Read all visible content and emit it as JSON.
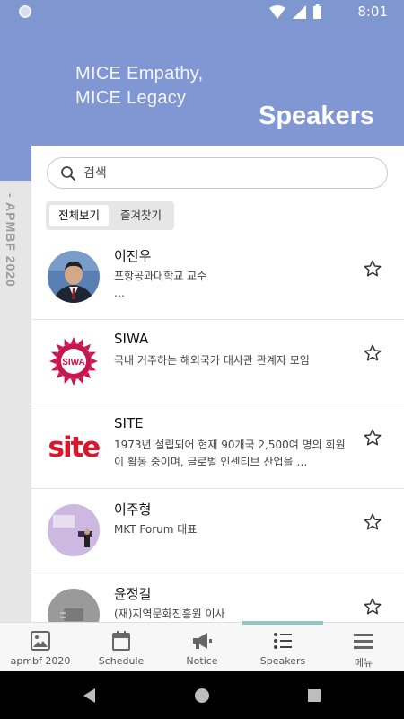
{
  "status_bar": {
    "time": "8:01"
  },
  "header": {
    "tagline_line1": "MICE Empathy,",
    "tagline_line2": "MICE Legacy",
    "title": "Speakers"
  },
  "side_label": "- APMBF 2020",
  "search": {
    "placeholder": "검색"
  },
  "filter_tabs": [
    {
      "label": "전체보기",
      "active": true
    },
    {
      "label": "즐겨찾기",
      "active": false
    }
  ],
  "speakers": [
    {
      "name": "이진우",
      "desc": "포항공과대학교 교수\n…",
      "favorited": false
    },
    {
      "name": "SIWA",
      "desc": "국내 거주하는 해외국가 대사관 관계자 모임",
      "favorited": false
    },
    {
      "name": "SITE",
      "desc": "1973년 설립되어 현재 90개국 2,500여 명의 회원이 활동 중이며, 글로벌 인센티브 산업을 …",
      "favorited": false
    },
    {
      "name": "이주형",
      "desc": "MKT Forum 대표",
      "favorited": false
    },
    {
      "name": "윤정길",
      "desc": "(재)지역문화진흥원 이사",
      "favorited": false
    }
  ],
  "bottom_nav": [
    {
      "label": "apmbf 2020",
      "icon": "image-icon",
      "active": false
    },
    {
      "label": "Schedule",
      "icon": "calendar-icon",
      "active": false
    },
    {
      "label": "Notice",
      "icon": "megaphone-icon",
      "active": false
    },
    {
      "label": "Speakers",
      "icon": "list-icon",
      "active": true
    },
    {
      "label": "메뉴",
      "icon": "hamburger-icon",
      "active": false
    }
  ],
  "colors": {
    "header_blue": "#8197d3",
    "active_tab_accent": "#8cc9c4",
    "siwa_red": "#c8174f",
    "site_red": "#d8182a"
  }
}
